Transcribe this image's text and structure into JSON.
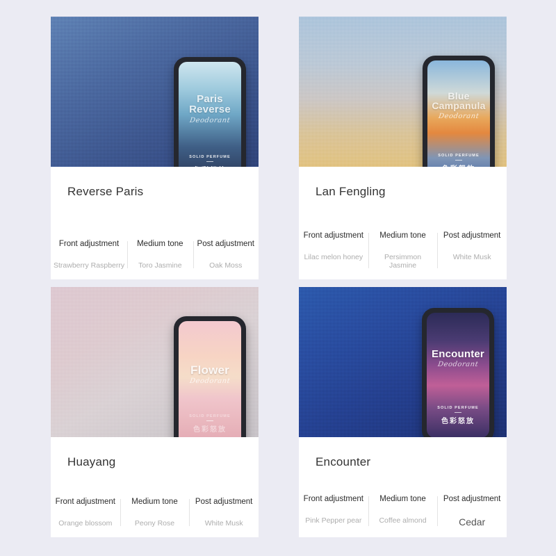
{
  "theme": {
    "page_background": "#ebebf3",
    "card_background": "#ffffff",
    "label_color": "#2b2b2b",
    "value_color": "#adadad",
    "divider_color": "#e3e3e3"
  },
  "tin_common": {
    "solid_perfume": "SOLID PERFUME",
    "chinese_slogan": "色彩怒放",
    "script": "Deodorant"
  },
  "note_headers": {
    "front": "Front adjustment",
    "middle": "Medium tone",
    "post": "Post adjustment"
  },
  "cards": [
    {
      "id": "reverse-paris",
      "title": "Reverse Paris",
      "tin_title": "Paris\nReverse",
      "tin_title_line1": "Paris",
      "tin_title_line2": "Reverse",
      "notes": {
        "front_label": "Front adjustment",
        "front_value": "Strawberry Raspberry",
        "middle_label": "Medium tone",
        "middle_value": "Toro Jasmine",
        "post_label": "Post adjustment",
        "post_value": "Oak Moss"
      }
    },
    {
      "id": "lan-fengling",
      "title": "Lan Fengling",
      "tin_title_line1": "Blue",
      "tin_title_line2": "Campanula",
      "notes": {
        "front_label": "Front adjustment",
        "front_value": "Lilac melon honey",
        "middle_label": "Medium tone",
        "middle_value": "Persimmon Jasmine",
        "post_label": "Post adjustment",
        "post_value": "White Musk"
      }
    },
    {
      "id": "huayang",
      "title": "Huayang",
      "tin_title_line1": "Flower",
      "tin_title_line2": "",
      "notes": {
        "front_label": "Front adjustment",
        "front_value": "Orange blossom",
        "middle_label": "Medium tone",
        "middle_value": "Peony Rose",
        "post_label": "Post adjustment",
        "post_value": "White Musk"
      }
    },
    {
      "id": "encounter",
      "title": "Encounter",
      "tin_title_line1": "Encounter",
      "tin_title_line2": "",
      "notes": {
        "front_label": "Front adjustment",
        "front_value": "Pink Pepper pear",
        "middle_label": "Medium tone",
        "middle_value": "Coffee almond",
        "post_label": "Post adjustment",
        "post_value": "Cedar"
      }
    }
  ]
}
